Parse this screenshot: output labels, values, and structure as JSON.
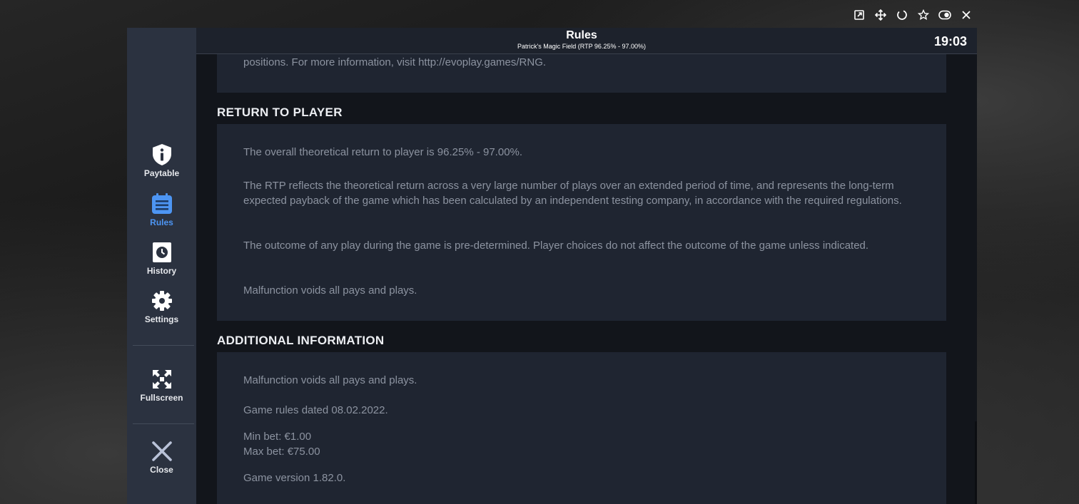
{
  "browser_controls": [
    "open-external-icon",
    "move-icon",
    "reload-icon",
    "star-icon",
    "theme-toggle-icon",
    "close-icon"
  ],
  "header": {
    "title": "Rules",
    "subtitle": "Patrick's Magic Field (RTP 96.25% - 97.00%)",
    "clock": "19:03"
  },
  "sidebar": {
    "items": [
      {
        "label": "Paytable",
        "icon": "info-shield-icon",
        "active": false
      },
      {
        "label": "Rules",
        "icon": "rules-list-icon",
        "active": true
      },
      {
        "label": "History",
        "icon": "history-clock-icon",
        "active": false
      },
      {
        "label": "Settings",
        "icon": "gear-icon",
        "active": false
      },
      {
        "label": "Fullscreen",
        "icon": "fullscreen-icon",
        "active": false
      },
      {
        "label": "Close",
        "icon": "close-x-icon",
        "active": false
      }
    ]
  },
  "content": {
    "rng_tail": "positions. For more information, visit http://evoplay.games/RNG.",
    "rtp_title": "RETURN TO PLAYER",
    "rtp_paragraphs": [
      "The overall theoretical return to player is 96.25% - 97.00%.",
      "The RTP reflects the theoretical return across a very large number of plays over an extended period of time, and represents the long-term expected payback of the game which has been calculated by an independent testing company, in accordance with the required regulations.",
      "The outcome of any play during the game is pre-determined. Player choices do not affect the outcome of the game unless indicated.",
      "Malfunction voids all pays and plays."
    ],
    "additional_title": "ADDITIONAL INFORMATION",
    "additional_lines": {
      "malfunction": "Malfunction voids all pays and plays.",
      "rules_date": "Game rules dated 08.02.2022.",
      "min_bet": "Min bet: €1.00",
      "max_bet": "Max bet: €75.00",
      "version": "Game version 1.82.0."
    }
  },
  "colors": {
    "accent": "#4d95f3",
    "sidebar_bg": "#2b3240",
    "card_bg": "#1f2531",
    "body_text": "#8c93a0"
  }
}
